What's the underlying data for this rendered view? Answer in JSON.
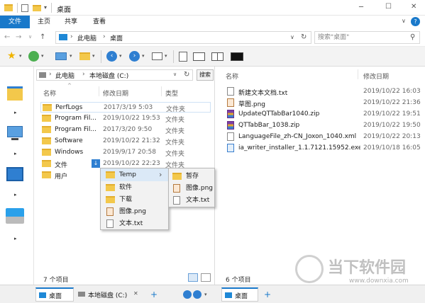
{
  "window": {
    "title": "桌面",
    "buttons": {
      "minimize": "─",
      "maximize": "☐",
      "close": "✕"
    }
  },
  "ribbon": {
    "tabs": [
      "文件",
      "主页",
      "共享",
      "查看"
    ],
    "help": "?"
  },
  "address": {
    "back": "←",
    "forward": "→",
    "up": "↑",
    "crumbs": [
      "此电脑",
      "桌面"
    ],
    "sep": "›",
    "dropdown": "∨",
    "refresh": "↻",
    "search_placeholder": "搜索\"桌面\"",
    "search_icon": "⚲"
  },
  "left_pane": {
    "address": {
      "crumbs": [
        "此电脑",
        "本地磁盘 (C:)"
      ],
      "search_button": "搜索"
    },
    "columns": {
      "name": "名称",
      "date": "修改日期",
      "type": "类型"
    },
    "rows": [
      {
        "name": "PerfLogs",
        "date": "2017/3/19 5:03",
        "type": "文件夹"
      },
      {
        "name": "Program Fil...",
        "date": "2019/10/22 19:53",
        "type": "文件夹"
      },
      {
        "name": "Program Fil...",
        "date": "2017/3/20 9:50",
        "type": "文件夹"
      },
      {
        "name": "Software",
        "date": "2019/10/22 21:32",
        "type": "文件夹"
      },
      {
        "name": "Windows",
        "date": "2019/9/17 20:58",
        "type": "文件夹"
      },
      {
        "name": "文件",
        "date": "2019/10/22 22:23",
        "type": "文件夹"
      },
      {
        "name": "用户",
        "date": "",
        "type": ""
      }
    ],
    "status": "7 个项目"
  },
  "right_pane": {
    "columns": {
      "name": "名称",
      "date": "修改日期"
    },
    "rows": [
      {
        "name": "新建文本文档.txt",
        "date": "2019/10/22 16:03"
      },
      {
        "name": "草图.png",
        "date": "2019/10/22 21:36"
      },
      {
        "name": "UpdateQTTabBar1040.zip",
        "date": "2019/10/22 19:51"
      },
      {
        "name": "QTTabBar_1038.zip",
        "date": "2019/10/22 19:50"
      },
      {
        "name": "LanguageFile_zh-CN_Joxon_1040.xml",
        "date": "2019/10/22 20:13"
      },
      {
        "name": "ia_writer_installer_1.1.7121.15952.exe",
        "date": "2019/10/18 16:05"
      }
    ],
    "status": "6 个项目"
  },
  "context_menu": {
    "items": [
      "Temp",
      "软件",
      "下载",
      "图像.png",
      "文本.txt"
    ],
    "submenu": [
      "暂存",
      "图像.png",
      "文本.txt"
    ],
    "arrow": "›"
  },
  "bottom_tabs": {
    "left": [
      "桌面",
      "本地磁盘 (C:)"
    ],
    "right": [
      "桌面"
    ],
    "close": "✕",
    "add": "+"
  },
  "watermark": {
    "brand": "当下软件园",
    "url": "www.downxia.com"
  },
  "colors": {
    "accent": "#1979ca",
    "folder": "#f3c84b",
    "selection": "#dbe9f7"
  }
}
